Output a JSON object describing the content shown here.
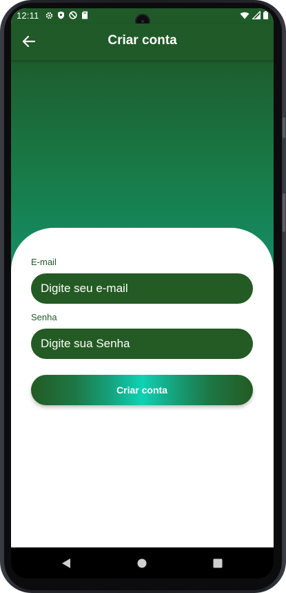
{
  "status_bar": {
    "time": "12:11",
    "left_icons": [
      "gear-icon",
      "shield-icon",
      "no-disturb-icon",
      "sd-card-icon"
    ],
    "right_icons": [
      "wifi-icon",
      "signal-icon",
      "battery-icon"
    ]
  },
  "app_bar": {
    "title": "Criar conta",
    "back_icon": "arrow-left-icon"
  },
  "form": {
    "email_label": "E-mail",
    "email_placeholder": "Digite seu e-mail",
    "password_label": "Senha",
    "password_placeholder": "Digite sua Senha",
    "submit_label": "Criar conta"
  },
  "nav_bar": {
    "icons": [
      "back-triangle-icon",
      "home-circle-icon",
      "recents-square-icon"
    ]
  },
  "colors": {
    "primary": "#1f5a28",
    "accent": "#0fd2b4",
    "field_bg": "#245a23"
  }
}
